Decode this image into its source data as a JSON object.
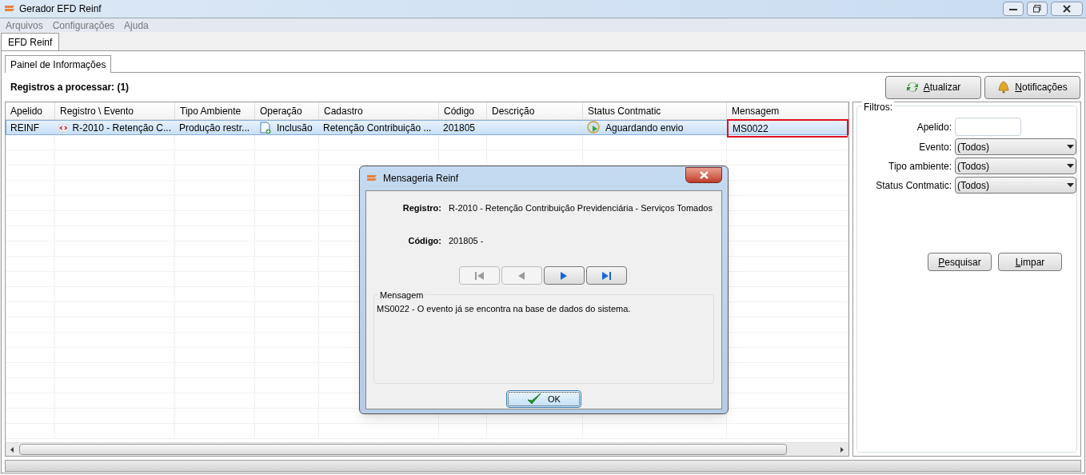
{
  "window": {
    "title": "Gerador EFD Reinf"
  },
  "menu": [
    "Arquivos",
    "Configurações",
    "Ajuda"
  ],
  "main_tabs": [
    {
      "label": "EFD Reinf",
      "selected": true
    }
  ],
  "panel_tabs": [
    {
      "label": "Painel de Informações",
      "selected": true
    }
  ],
  "summary": "Registros a processar: (1)",
  "toolbar": [
    {
      "label": "Atualizar",
      "kind": "refresh"
    },
    {
      "label": "Notificações",
      "kind": "bell"
    }
  ],
  "table": {
    "columns": [
      "Apelido",
      "Registro \\ Evento",
      "Tipo Ambiente",
      "Operação",
      "Cadastro",
      "Código",
      "Descrição",
      "Status Contmatic",
      "Mensagem"
    ],
    "rows": [
      {
        "selected": true,
        "apelido": "REINF",
        "registro": "R-2010 - Retenção C...",
        "tipo_ambiente": "Produção restr...",
        "operacao": "Inclusão",
        "cadastro": "Retenção Contribuição ...",
        "codigo": "201805",
        "status": "Aguardando envio",
        "mensagem": "MS0022",
        "mensagem_highlighted": true
      }
    ]
  },
  "filters": {
    "title": "Filtros:",
    "fields": [
      {
        "kind": "text",
        "label": "Apelido:"
      },
      {
        "kind": "select",
        "label": "Evento:",
        "value": "(Todos)"
      },
      {
        "kind": "select",
        "label": "Tipo ambiente:",
        "value": "(Todos)"
      },
      {
        "kind": "select",
        "label": "Status Contmatic:",
        "value": "(Todos)"
      }
    ],
    "buttons": [
      "Pesquisar",
      "Limpar"
    ]
  },
  "dialog": {
    "title": "Mensageria Reinf",
    "fields": [
      {
        "label": "Registro:",
        "value": "R-2010 - Retenção Contribuição Previdenciária - Serviços Tomados"
      },
      {
        "label": "Código:",
        "value": "201805 -"
      }
    ],
    "nav_buttons": [
      {
        "kind": "first",
        "disabled": true
      },
      {
        "kind": "prev",
        "disabled": true
      },
      {
        "kind": "next",
        "disabled": false
      },
      {
        "kind": "last",
        "disabled": false
      }
    ],
    "message_title": "Mensagem",
    "message": "MS0022 - O evento já se encontra na base de dados do sistema.",
    "ok": "OK"
  }
}
